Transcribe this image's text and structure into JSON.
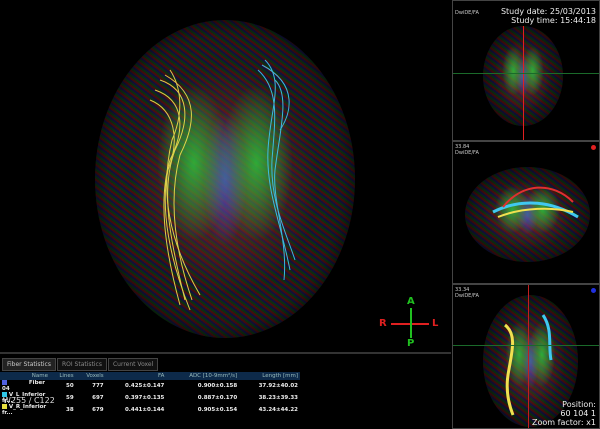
{
  "main_view": {
    "window_level": "W255 / C122",
    "orientation": {
      "anterior": "A",
      "posterior": "P",
      "right": "R",
      "left": "L"
    }
  },
  "side_views": [
    {
      "label": "DwiDE/FA",
      "study_date": "Study date: 25/03/2013",
      "study_time": "Study time: 15:44:18"
    },
    {
      "index": "33.84",
      "label": "DwiDE/FA"
    },
    {
      "index": "33.34",
      "label": "DwiDE/FA",
      "position_label": "Position:",
      "position": "60 104 1",
      "zoom": "Zoom factor: x1"
    }
  ],
  "tabs": [
    {
      "label": "Fiber Statistics",
      "active": true
    },
    {
      "label": "ROI Statistics"
    },
    {
      "label": "Current Voxel"
    }
  ],
  "table": {
    "headers": [
      "Name",
      "Lines",
      "Voxels",
      "FA",
      "ADC [10-9mm²/s]",
      "Length [mm]"
    ],
    "rows": [
      {
        "color": "#5060e0",
        "cells": [
          "Fiber 04",
          "50",
          "777",
          "0.425±0.147",
          "0.900±0.158",
          "37.92±40.02"
        ]
      },
      {
        "color": "#30c8e8",
        "cells": [
          "V_L_Inferior fr...",
          "59",
          "697",
          "0.397±0.135",
          "0.887±0.170",
          "38.23±39.33"
        ]
      },
      {
        "color": "#e8e040",
        "cells": [
          "V_R_Inferior fr...",
          "38",
          "679",
          "0.441±0.144",
          "0.905±0.154",
          "43.24±44.22"
        ]
      }
    ]
  },
  "colors": {
    "fiber_yellow": "#f0e050",
    "fiber_cyan": "#40c8f0",
    "crosshair_red": "#e02020",
    "crosshair_green": "#20c020"
  }
}
